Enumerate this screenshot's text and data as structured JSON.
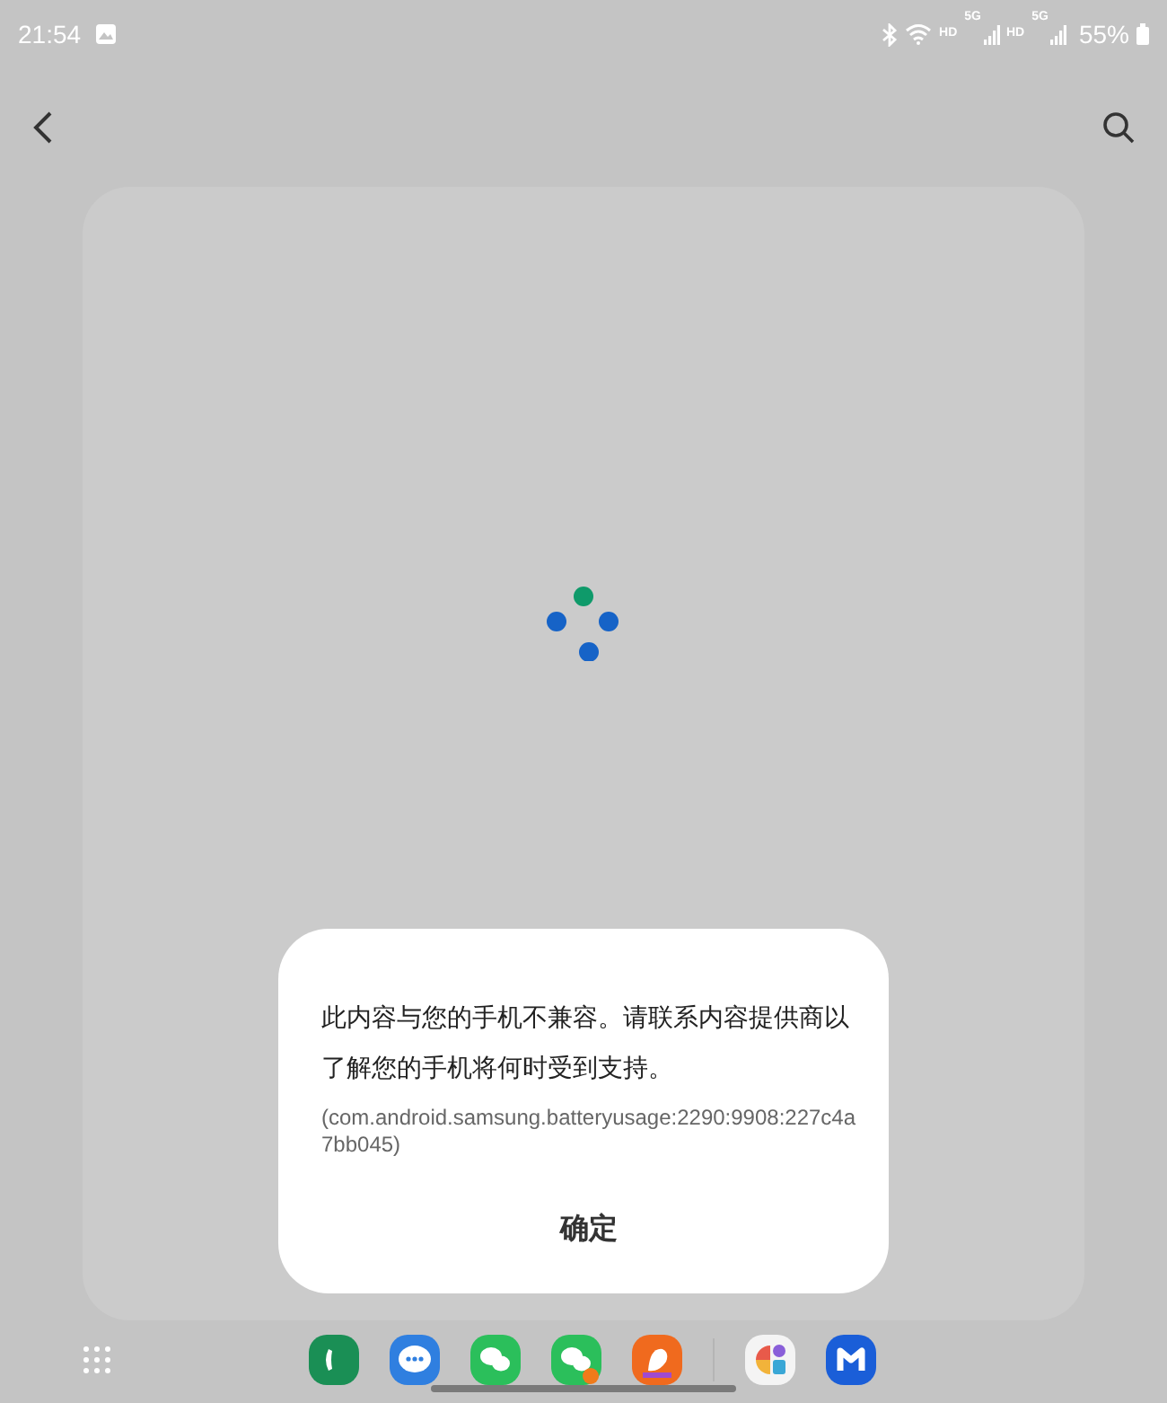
{
  "status_bar": {
    "time": "21:54",
    "network_labels": [
      "HD",
      "5G",
      "HD",
      "5G"
    ],
    "battery": "55%"
  },
  "dialog": {
    "message": "此内容与您的手机不兼容。请联系内容提供商以了解您的手机将何时受到支持。",
    "detail": "(com.android.samsung.batteryusage:2290:9908:227c4a7bb045)",
    "button": "确定"
  },
  "dock": {
    "apps": [
      {
        "color": "#1a8f55"
      },
      {
        "color": "#2f7fe0"
      },
      {
        "color": "#2bbf5b"
      },
      {
        "color": "#2bbf5b"
      },
      {
        "color": "#f06a1e"
      },
      {
        "color": "#f4f4f4"
      },
      {
        "color": "#1a5ed8"
      }
    ]
  }
}
